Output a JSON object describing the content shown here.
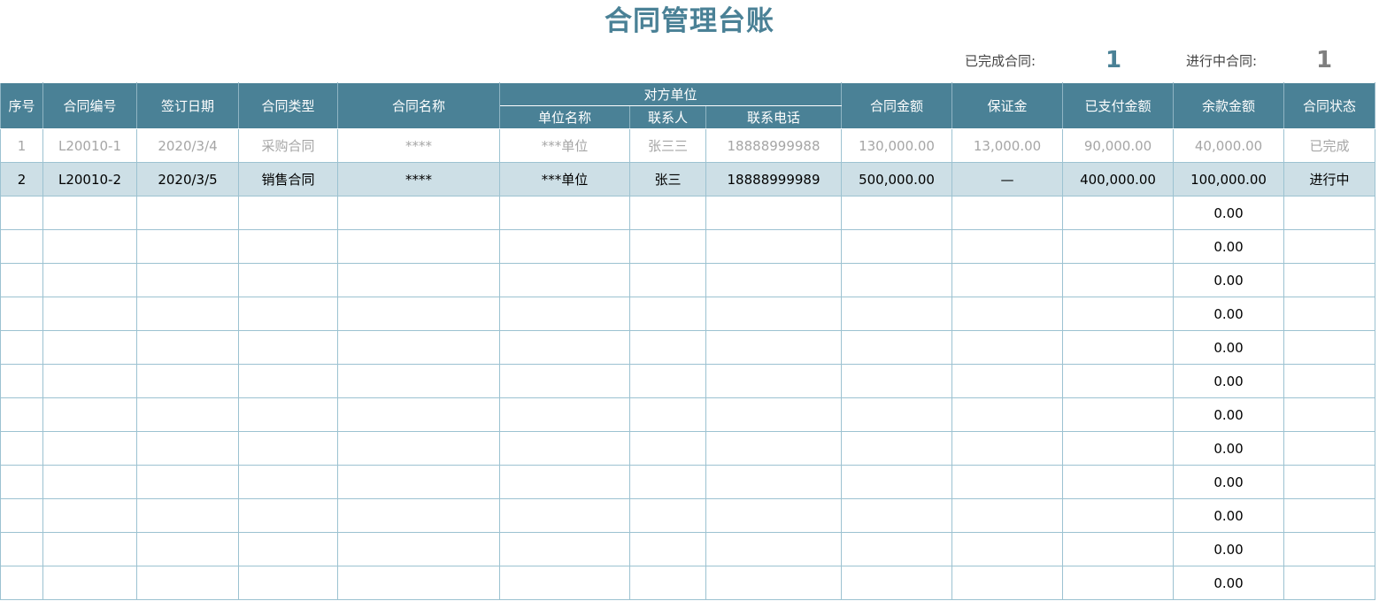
{
  "title": "合同管理台账",
  "summary": {
    "completed_label": "已完成合同:",
    "completed_value": "1",
    "completed_color": "#4a8196",
    "in_progress_label": "进行中合同:",
    "in_progress_value": "1",
    "in_progress_color": "#7f7f7f"
  },
  "headers": {
    "seq": "序号",
    "contract_no": "合同编号",
    "sign_date": "签订日期",
    "contract_type": "合同类型",
    "contract_name": "合同名称",
    "counterparty": "对方单位",
    "unit_name": "单位名称",
    "contact": "联系人",
    "phone": "联系电话",
    "amount": "合同金额",
    "deposit": "保证金",
    "paid": "已支付金额",
    "balance": "余款金额",
    "status": "合同状态"
  },
  "chart_data": {
    "type": "table",
    "title": "合同管理台账",
    "rows": [
      {
        "seq": "1",
        "contract_no": "L20010-1",
        "sign_date": "2020/3/4",
        "contract_type": "采购合同",
        "contract_name": "****",
        "unit_name": "***单位",
        "contact": "张三三",
        "phone": "18888999988",
        "amount": "130,000.00",
        "deposit": "13,000.00",
        "paid": "90,000.00",
        "balance": "40,000.00",
        "status": "已完成"
      },
      {
        "seq": "2",
        "contract_no": "L20010-2",
        "sign_date": "2020/3/5",
        "contract_type": "销售合同",
        "contract_name": "****",
        "unit_name": "***单位",
        "contact": "张三",
        "phone": "18888999989",
        "amount": "500,000.00",
        "deposit": "—",
        "paid": "400,000.00",
        "balance": "100,000.00",
        "status": "进行中"
      },
      {
        "balance": "0.00"
      },
      {
        "balance": "0.00"
      },
      {
        "balance": "0.00"
      },
      {
        "balance": "0.00"
      },
      {
        "balance": "0.00"
      },
      {
        "balance": "0.00"
      },
      {
        "balance": "0.00"
      },
      {
        "balance": "0.00"
      },
      {
        "balance": "0.00"
      },
      {
        "balance": "0.00"
      },
      {
        "balance": "0.00"
      },
      {
        "balance": "0.00"
      }
    ]
  },
  "colors": {
    "header_bg": "#4a8196",
    "title": "#4a8196",
    "active_row_bg": "#cddfe6",
    "completed_text": "#a6a6a6",
    "grid": "#9cc2d1"
  }
}
